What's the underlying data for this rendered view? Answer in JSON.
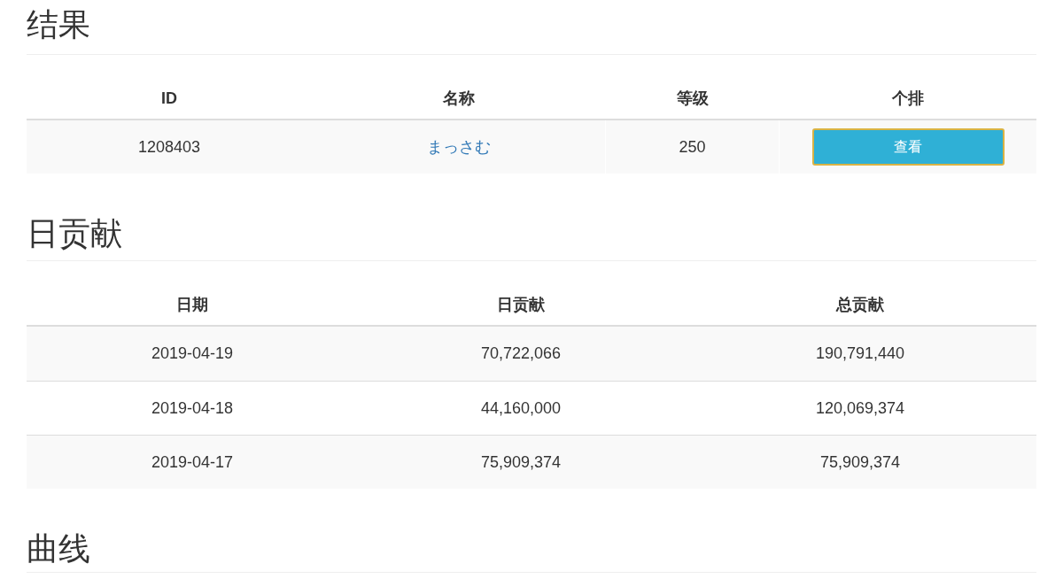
{
  "result": {
    "heading": "结果",
    "columns": [
      "ID",
      "名称",
      "等级",
      "个排"
    ],
    "row": {
      "id": "1208403",
      "name": "まっさむ",
      "level": "250",
      "action": "查看"
    }
  },
  "daily": {
    "heading": "日贡献",
    "columns": [
      "日期",
      "日贡献",
      "总贡献"
    ],
    "rows": [
      [
        "2019-04-19",
        "70,722,066",
        "190,791,440"
      ],
      [
        "2019-04-18",
        "44,160,000",
        "120,069,374"
      ],
      [
        "2019-04-17",
        "75,909,374",
        "75,909,374"
      ]
    ]
  },
  "curve": {
    "heading": "曲线"
  }
}
